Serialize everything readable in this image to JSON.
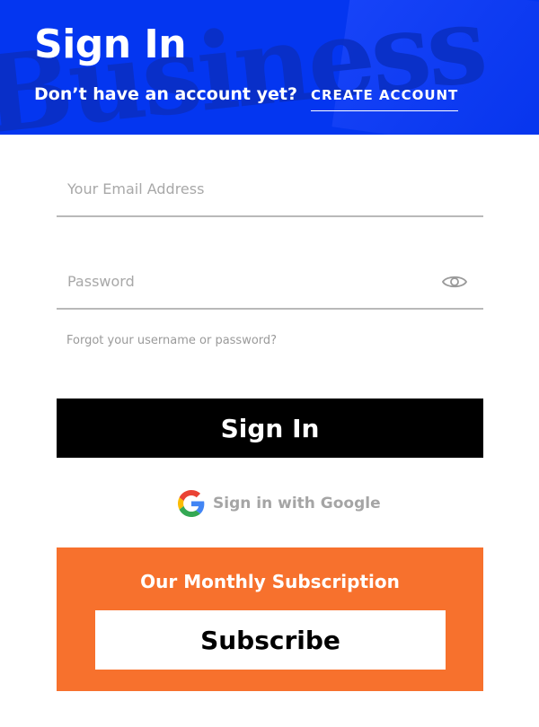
{
  "header": {
    "title": "Sign In",
    "prompt": "Don’t have an account yet?",
    "create_account_label": "CREATE ACCOUNT",
    "background_color": "#0436f0"
  },
  "form": {
    "email_placeholder": "Your Email Address",
    "email_value": "",
    "password_placeholder": "Password",
    "password_value": "",
    "password_toggle_icon": "eye-icon",
    "forgot_label": "Forgot your username or password?",
    "signin_label": "Sign In"
  },
  "google": {
    "label": "Sign in with Google",
    "icon": "google-icon"
  },
  "subscription": {
    "title": "Our Monthly Subscription",
    "subscribe_label": "Subscribe",
    "background_color": "#f7712d"
  }
}
